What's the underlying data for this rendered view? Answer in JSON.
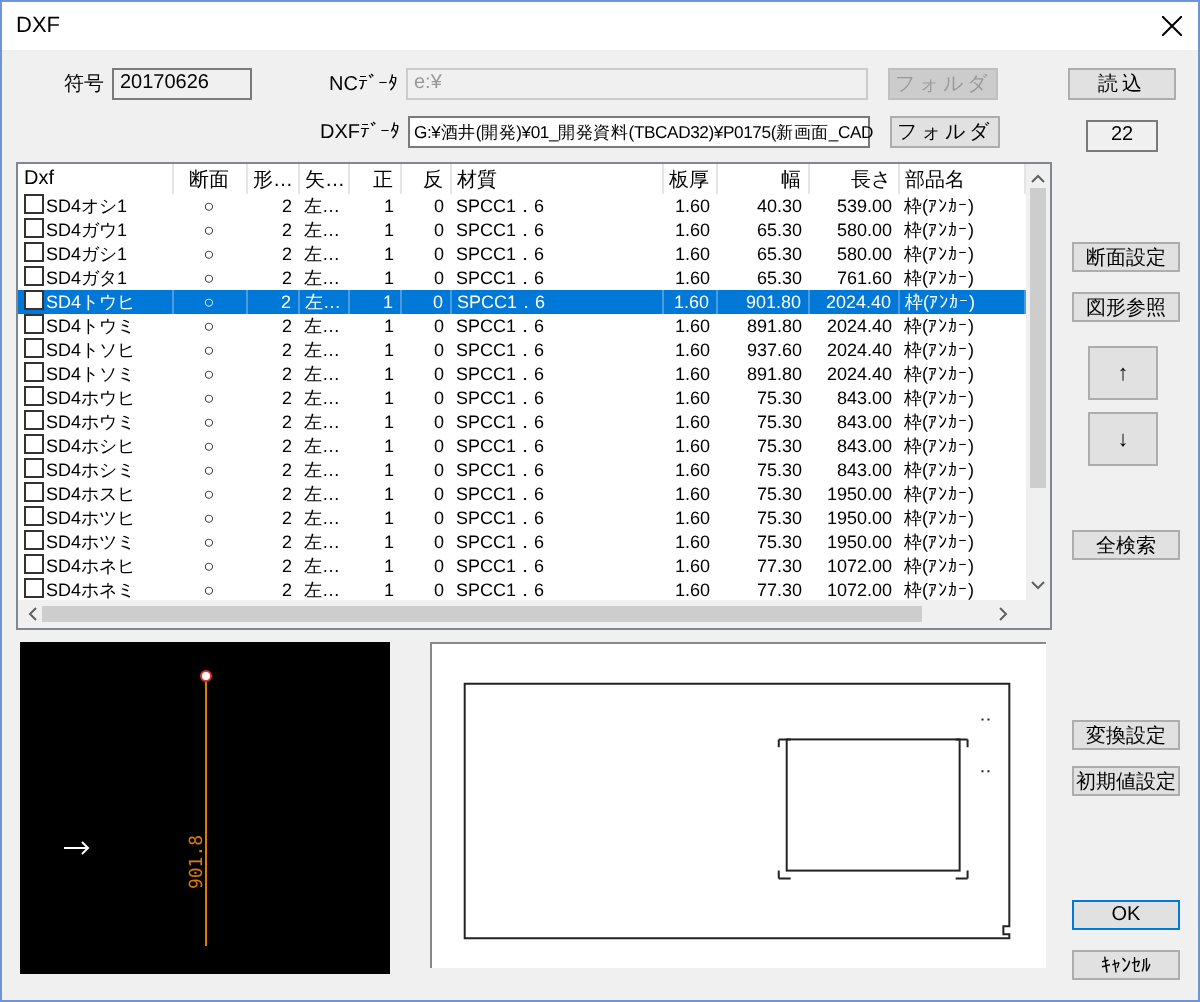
{
  "window": {
    "title": "DXF"
  },
  "code": {
    "label": "符号",
    "value": "20170626"
  },
  "nc_data": {
    "label": "NCﾃﾞｰﾀ",
    "value": "e:¥",
    "button": "フォルダ",
    "disabled": true
  },
  "dxf_data": {
    "label": "DXFﾃﾞｰﾀ",
    "value": "G:¥酒井(開発)¥01_開発資料(TBCAD32)¥P0175(新画面_CAD",
    "button": "フォルダ",
    "disabled": false
  },
  "load_button": "読込",
  "count": "22",
  "table": {
    "columns": [
      "Dxf",
      "断面",
      "形…",
      "矢…",
      "正",
      "反",
      "材質",
      "板厚",
      "幅",
      "長さ",
      "部品名"
    ],
    "rows": [
      {
        "checked": false,
        "selected": false,
        "cells": [
          "SD4オシ1",
          "○",
          "2",
          "左…",
          "1",
          "0",
          "SPCC1．6",
          "1.60",
          "40.30",
          "539.00",
          "枠(ｱﾝｶｰ)"
        ]
      },
      {
        "checked": false,
        "selected": false,
        "cells": [
          "SD4ガウ1",
          "○",
          "2",
          "左…",
          "1",
          "0",
          "SPCC1．6",
          "1.60",
          "65.30",
          "580.00",
          "枠(ｱﾝｶｰ)"
        ]
      },
      {
        "checked": false,
        "selected": false,
        "cells": [
          "SD4ガシ1",
          "○",
          "2",
          "左…",
          "1",
          "0",
          "SPCC1．6",
          "1.60",
          "65.30",
          "580.00",
          "枠(ｱﾝｶｰ)"
        ]
      },
      {
        "checked": false,
        "selected": false,
        "cells": [
          "SD4ガタ1",
          "○",
          "2",
          "左…",
          "1",
          "0",
          "SPCC1．6",
          "1.60",
          "65.30",
          "761.60",
          "枠(ｱﾝｶｰ)"
        ]
      },
      {
        "checked": false,
        "selected": true,
        "cells": [
          "SD4トウヒ",
          "○",
          "2",
          "左…",
          "1",
          "0",
          "SPCC1．6",
          "1.60",
          "901.80",
          "2024.40",
          "枠(ｱﾝｶｰ)"
        ]
      },
      {
        "checked": false,
        "selected": false,
        "cells": [
          "SD4トウミ",
          "○",
          "2",
          "左…",
          "1",
          "0",
          "SPCC1．6",
          "1.60",
          "891.80",
          "2024.40",
          "枠(ｱﾝｶｰ)"
        ]
      },
      {
        "checked": false,
        "selected": false,
        "cells": [
          "SD4トソヒ",
          "○",
          "2",
          "左…",
          "1",
          "0",
          "SPCC1．6",
          "1.60",
          "937.60",
          "2024.40",
          "枠(ｱﾝｶｰ)"
        ]
      },
      {
        "checked": false,
        "selected": false,
        "cells": [
          "SD4トソミ",
          "○",
          "2",
          "左…",
          "1",
          "0",
          "SPCC1．6",
          "1.60",
          "891.80",
          "2024.40",
          "枠(ｱﾝｶｰ)"
        ]
      },
      {
        "checked": false,
        "selected": false,
        "cells": [
          "SD4ホウヒ",
          "○",
          "2",
          "左…",
          "1",
          "0",
          "SPCC1．6",
          "1.60",
          "75.30",
          "843.00",
          "枠(ｱﾝｶｰ)"
        ]
      },
      {
        "checked": false,
        "selected": false,
        "cells": [
          "SD4ホウミ",
          "○",
          "2",
          "左…",
          "1",
          "0",
          "SPCC1．6",
          "1.60",
          "75.30",
          "843.00",
          "枠(ｱﾝｶｰ)"
        ]
      },
      {
        "checked": false,
        "selected": false,
        "cells": [
          "SD4ホシヒ",
          "○",
          "2",
          "左…",
          "1",
          "0",
          "SPCC1．6",
          "1.60",
          "75.30",
          "843.00",
          "枠(ｱﾝｶｰ)"
        ]
      },
      {
        "checked": false,
        "selected": false,
        "cells": [
          "SD4ホシミ",
          "○",
          "2",
          "左…",
          "1",
          "0",
          "SPCC1．6",
          "1.60",
          "75.30",
          "843.00",
          "枠(ｱﾝｶｰ)"
        ]
      },
      {
        "checked": false,
        "selected": false,
        "cells": [
          "SD4ホスヒ",
          "○",
          "2",
          "左…",
          "1",
          "0",
          "SPCC1．6",
          "1.60",
          "75.30",
          "1950.00",
          "枠(ｱﾝｶｰ)"
        ]
      },
      {
        "checked": false,
        "selected": false,
        "cells": [
          "SD4ホツヒ",
          "○",
          "2",
          "左…",
          "1",
          "0",
          "SPCC1．6",
          "1.60",
          "75.30",
          "1950.00",
          "枠(ｱﾝｶｰ)"
        ]
      },
      {
        "checked": false,
        "selected": false,
        "cells": [
          "SD4ホツミ",
          "○",
          "2",
          "左…",
          "1",
          "0",
          "SPCC1．6",
          "1.60",
          "75.30",
          "1950.00",
          "枠(ｱﾝｶｰ)"
        ]
      },
      {
        "checked": false,
        "selected": false,
        "cells": [
          "SD4ホネヒ",
          "○",
          "2",
          "左…",
          "1",
          "0",
          "SPCC1．6",
          "1.60",
          "77.30",
          "1072.00",
          "枠(ｱﾝｶｰ)"
        ]
      },
      {
        "checked": false,
        "selected": false,
        "cells": [
          "SD4ホネミ",
          "○",
          "2",
          "左…",
          "1",
          "0",
          "SPCC1．6",
          "1.60",
          "77.30",
          "1072.00",
          "枠(ｱﾝｶｰ)"
        ]
      }
    ]
  },
  "side_buttons": [
    {
      "label": "断面設定",
      "kind": "push",
      "default": false
    },
    {
      "label": "図形参照",
      "kind": "push",
      "default": false
    },
    {
      "label": "↑",
      "kind": "arrow",
      "default": false
    },
    {
      "label": "↓",
      "kind": "arrow",
      "default": false
    },
    {
      "label": "全検索",
      "kind": "push",
      "default": false
    },
    {
      "label": "変換設定",
      "kind": "push",
      "default": false
    },
    {
      "label": "初期値設定",
      "kind": "push",
      "default": false
    },
    {
      "label": "OK",
      "kind": "push",
      "default": true
    },
    {
      "label": "ｷｬﾝｾﾙ",
      "kind": "push",
      "default": false
    }
  ],
  "preview": {
    "dimension": "901.8"
  }
}
